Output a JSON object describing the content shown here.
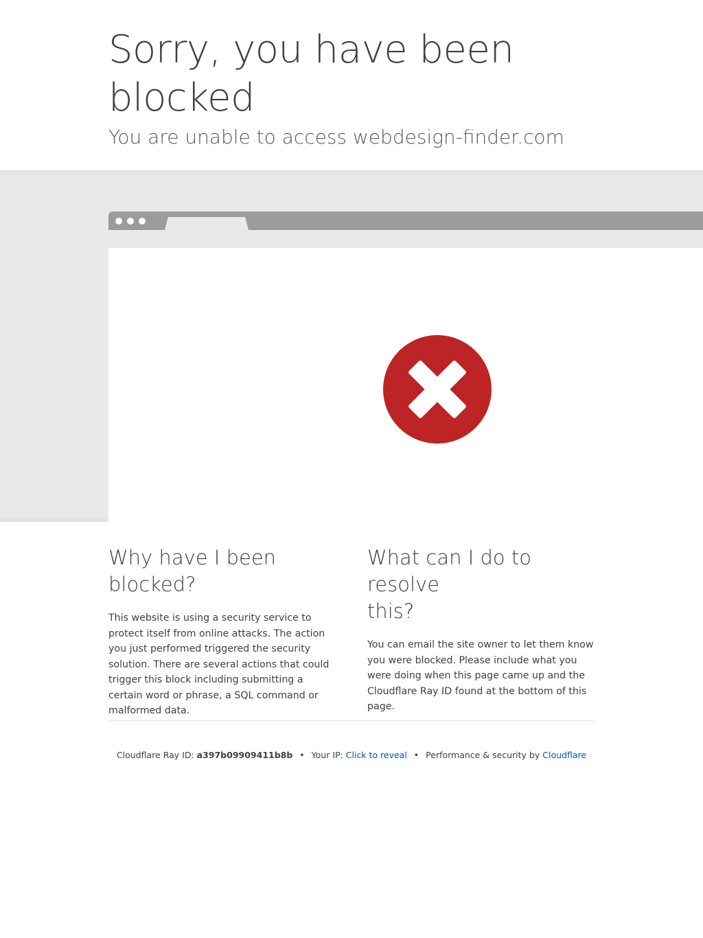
{
  "header": {
    "title_line1": "Sorry, you have been",
    "title_line2": "blocked",
    "subtitle": "You are unable to access webdesign-finder.com"
  },
  "browser_graphic": {
    "icon": "error-x-icon",
    "icon_color": "#bd2426",
    "bar_color": "#9b9b9b",
    "band_color": "#e9e9e9"
  },
  "why": {
    "heading_line1": "Why have I been",
    "heading_line2": "blocked?",
    "body": "This website is using a security service to protect itself from online attacks. The action you just performed triggered the security solution. There are several actions that could trigger this block including submitting a certain word or phrase, a SQL command or malformed data."
  },
  "resolve": {
    "heading_line1": "What can I do to resolve",
    "heading_line2": "this?",
    "body": "You can email the site owner to let them know you were blocked. Please include what you were doing when this page came up and the Cloudflare Ray ID found at the bottom of this page."
  },
  "footer": {
    "ray_label": "Cloudflare Ray ID:",
    "ray_id": "a397b09909411b8b",
    "separator": "•",
    "ip_label": "Your IP:",
    "ip_link": "Click to reveal",
    "perf_label": "Performance & security by",
    "cloudflare_link": "Cloudflare",
    "link_color": "#0051c3"
  }
}
